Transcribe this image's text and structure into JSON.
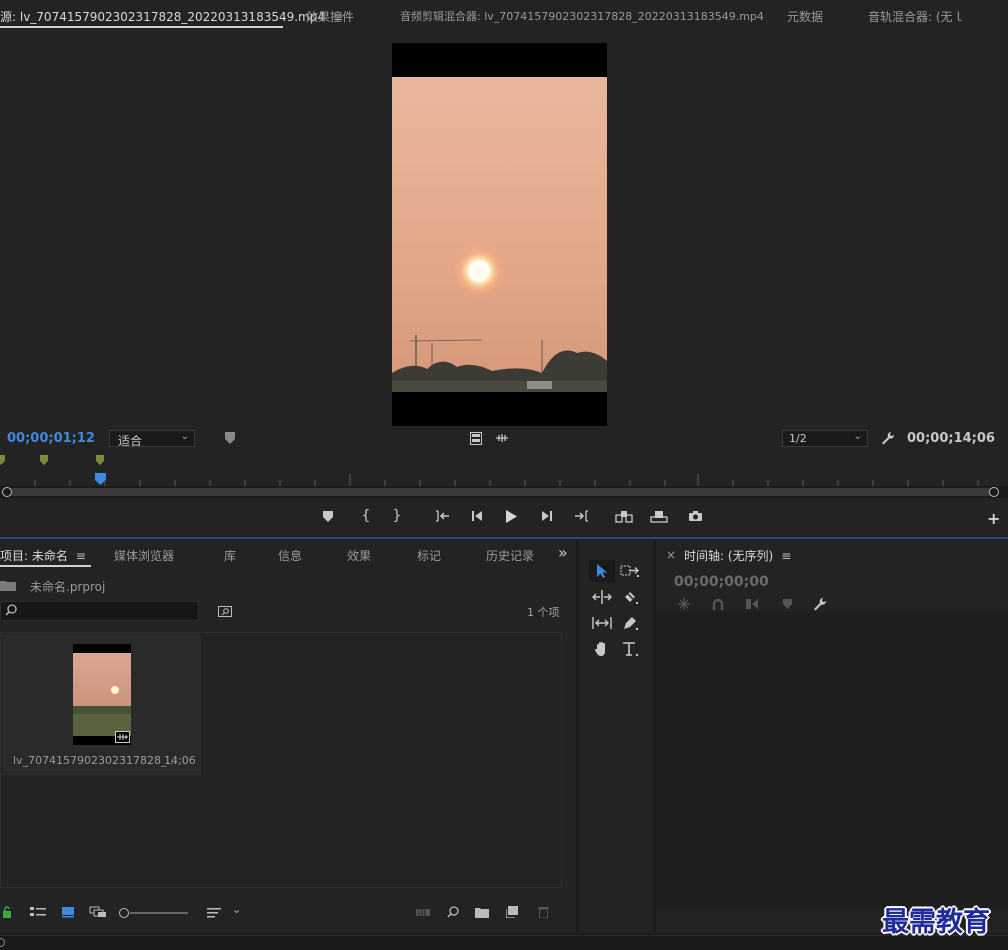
{
  "source_panel": {
    "tabs": [
      {
        "label": "源: lv_7074157902302317828_20220313183549.mp4",
        "active": true
      },
      {
        "label": "效果控件",
        "active": false
      },
      {
        "label": "音频剪辑混合器: lv_7074157902302317828_20220313183549.mp4",
        "active": false
      },
      {
        "label": "元数据",
        "active": false
      },
      {
        "label": "音轨混合器: (无ｌ",
        "active": false
      }
    ],
    "menu_glyph": "≡",
    "current_timecode": "00;00;01;12",
    "fit_label": "适合",
    "resolution_label": "1/2",
    "duration_timecode": "00;00;14;06",
    "add_glyph": "+"
  },
  "project_panel": {
    "tabs": [
      {
        "label": "项目: 未命名",
        "active": true
      },
      {
        "label": "媒体浏览器",
        "active": false
      },
      {
        "label": "库",
        "active": false
      },
      {
        "label": "信息",
        "active": false
      },
      {
        "label": "效果",
        "active": false
      },
      {
        "label": "标记",
        "active": false
      },
      {
        "label": "历史记录",
        "active": false
      }
    ],
    "overflow_glyph": "»",
    "project_file": "未命名.prproj",
    "search_placeholder": "",
    "item_count": "1 个项",
    "clip": {
      "name": "lv_7074157902302317828_...",
      "duration": "14;06"
    }
  },
  "timeline_panel": {
    "close_glyph": "×",
    "title": "时间轴: (无序列)",
    "timecode": "00;00;00;00"
  },
  "watermark": "最需教育",
  "colors": {
    "accent": "#3e8ae0",
    "marker_green": "#7c8a3a",
    "panel_bg": "#232323",
    "app_bg": "#1d1d1d"
  }
}
